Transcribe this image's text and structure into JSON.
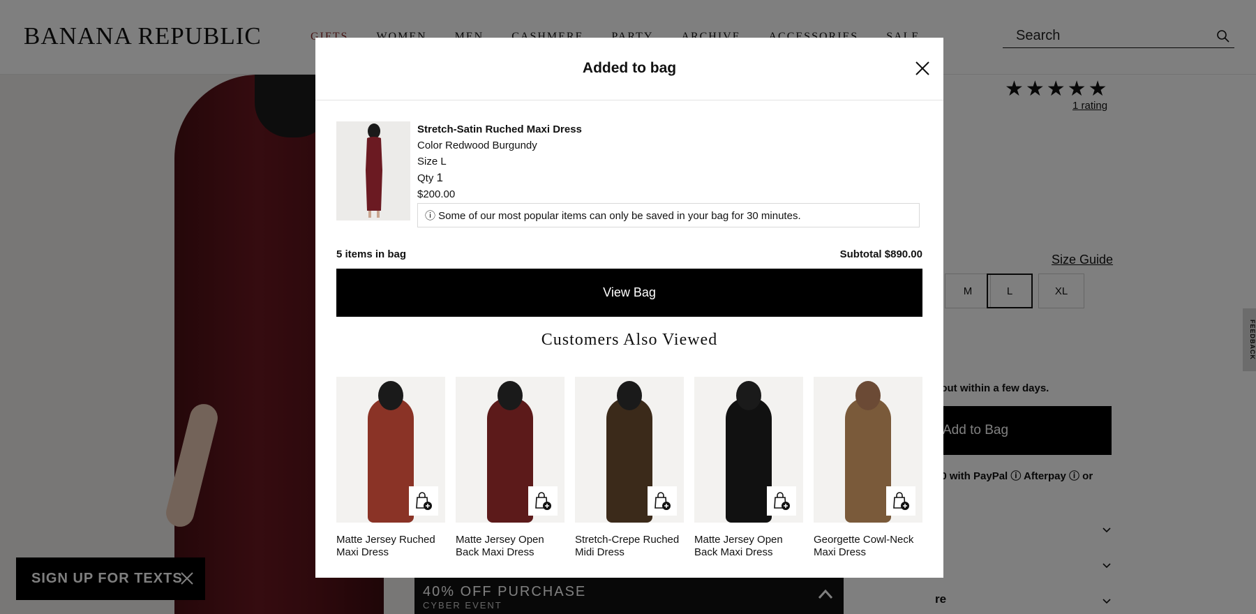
{
  "header": {
    "logo": "BANANA REPUBLIC",
    "nav": [
      "GIFTS",
      "WOMEN",
      "MEN",
      "CASHMERE",
      "PARTY",
      "ARCHIVE",
      "ACCESSORIES",
      "SALE"
    ],
    "search_placeholder": "Search"
  },
  "product": {
    "stars": "★★★★★",
    "rating_link": "1 rating",
    "size_guide": "Size Guide",
    "sizes": [
      "M",
      "L",
      "XL"
    ],
    "selected_size": "L",
    "sellout_text": "l out within a few days.",
    "add_to_bag": "Add to Bag",
    "pay_text": "00 with PayPal ⓘ Afterpay ⓘ or",
    "more_text": "re",
    "feedback": "FEEDBACK"
  },
  "promo": {
    "title": "40% OFF PURCHASE",
    "subtitle": "CYBER EVENT"
  },
  "texts_signup": "SIGN UP FOR TEXTS",
  "modal": {
    "title": "Added to bag",
    "item": {
      "name": "Stretch-Satin Ruched Maxi Dress",
      "color": "Color Redwood Burgundy",
      "size": "Size L",
      "qty_label": "Qty",
      "qty_value": "1",
      "price": "$200.00"
    },
    "notice": "ⓘ Some of our most popular items can only be saved in your bag for 30 minutes.",
    "bag_count": "5 items in bag",
    "subtotal": "Subtotal $890.00",
    "view_bag": "View Bag",
    "also_viewed_title": "Customers Also Viewed",
    "recommendations": [
      {
        "name": "Matte Jersey Ruched Maxi Dress",
        "color": "#8a3326"
      },
      {
        "name": "Matte Jersey Open Back Maxi Dress",
        "color": "#5c1a1a"
      },
      {
        "name": "Stretch-Crepe Ruched Midi Dress",
        "color": "#3b2a1a"
      },
      {
        "name": "Matte Jersey Open Back Maxi Dress",
        "color": "#111111"
      },
      {
        "name": "Georgette Cowl-Neck Maxi Dress",
        "color": "#7a5a3a"
      }
    ]
  }
}
